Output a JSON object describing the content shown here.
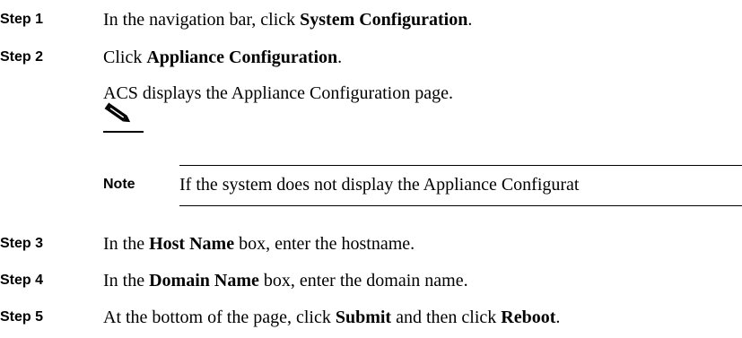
{
  "steps": [
    {
      "label": "Step 1",
      "pre": "In the navigation bar, click ",
      "bold": "System Configuration",
      "post": "."
    },
    {
      "label": "Step 2",
      "pre": "Click ",
      "bold": "Appliance Configuration",
      "post": "."
    },
    {
      "label": "Step 3",
      "pre": "In the ",
      "bold": "Host Name",
      "post": " box, enter the hostname."
    },
    {
      "label": "Step 4",
      "pre": "In the ",
      "bold": "Domain Name",
      "post": " box, enter the domain name."
    },
    {
      "label": "Step 5",
      "pre": "At the bottom of the page, click ",
      "bold": "Submit",
      "mid": " and then click ",
      "bold2": "Reboot",
      "post": "."
    }
  ],
  "step2_result": "ACS displays the Appliance Configuration page.",
  "note": {
    "icon": "pencil-note-icon",
    "label": "Note",
    "text": "If the system does not display the Appliance Configurat"
  }
}
